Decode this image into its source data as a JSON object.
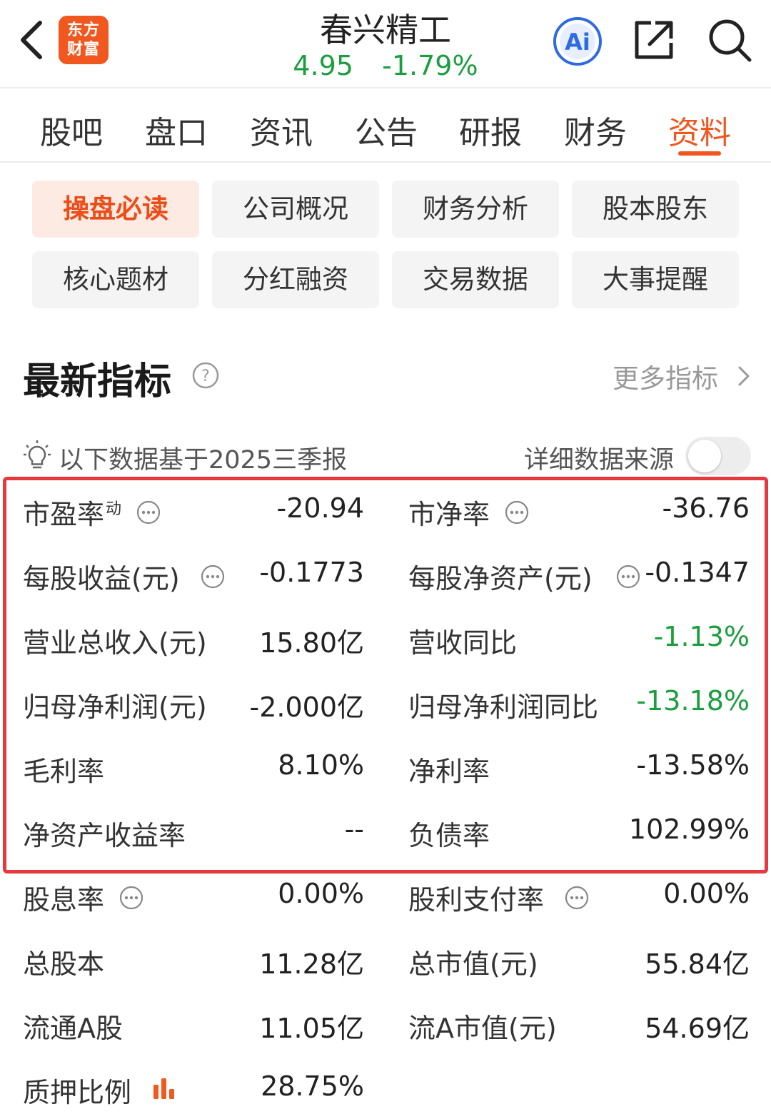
{
  "header": {
    "logo_line1": "东方",
    "logo_line2": "财富",
    "stock_name": "春兴精工",
    "price": "4.95",
    "change_pct": "-1.79%",
    "ai_label": "Ai"
  },
  "tabs": [
    {
      "label": "股吧"
    },
    {
      "label": "盘口"
    },
    {
      "label": "资讯"
    },
    {
      "label": "公告"
    },
    {
      "label": "研报"
    },
    {
      "label": "财务"
    },
    {
      "label": "资料",
      "active": true
    }
  ],
  "sub_buttons": [
    {
      "label": "操盘必读",
      "active": true
    },
    {
      "label": "公司概况"
    },
    {
      "label": "财务分析"
    },
    {
      "label": "股本股东"
    },
    {
      "label": "核心题材"
    },
    {
      "label": "分红融资"
    },
    {
      "label": "交易数据"
    },
    {
      "label": "大事提醒"
    }
  ],
  "section": {
    "title": "最新指标",
    "more_label": "更多指标",
    "note": "以下数据基于2025三季报",
    "source_label": "详细数据来源"
  },
  "indicators": {
    "pe": {
      "label": "市盈率",
      "sup": "动",
      "value": "-20.94"
    },
    "pb": {
      "label": "市净率",
      "value": "-36.76"
    },
    "eps": {
      "label": "每股收益(元)",
      "value": "-0.1773"
    },
    "bvps": {
      "label": "每股净资产(元)",
      "value": "-0.1347"
    },
    "revenue": {
      "label": "营业总收入(元)",
      "value": "15.80亿"
    },
    "revenue_yoy": {
      "label": "营收同比",
      "value": "-1.13%"
    },
    "net_profit": {
      "label": "归母净利润(元)",
      "value": "-2.000亿"
    },
    "net_profit_yoy": {
      "label": "归母净利润同比",
      "value": "-13.18%"
    },
    "gross_margin": {
      "label": "毛利率",
      "value": "8.10%"
    },
    "net_margin": {
      "label": "净利率",
      "value": "-13.58%"
    },
    "roe": {
      "label": "净资产收益率",
      "value": "--"
    },
    "debt_ratio": {
      "label": "负债率",
      "value": "102.99%"
    },
    "dividend_yield": {
      "label": "股息率",
      "value": "0.00%"
    },
    "payout_ratio": {
      "label": "股利支付率",
      "value": "0.00%"
    },
    "total_shares": {
      "label": "总股本",
      "value": "11.28亿"
    },
    "market_cap": {
      "label": "总市值(元)",
      "value": "55.84亿"
    },
    "float_a": {
      "label": "流通A股",
      "value": "11.05亿"
    },
    "float_a_cap": {
      "label": "流A市值(元)",
      "value": "54.69亿"
    },
    "pledge_ratio": {
      "label": "质押比例",
      "value": "28.75%"
    }
  },
  "colors": {
    "accent": "#f0561e",
    "up_down_green": "#1b9e3e",
    "highlight_red": "#e5383f",
    "ai_blue": "#2f6be0"
  },
  "toggle_on": false
}
